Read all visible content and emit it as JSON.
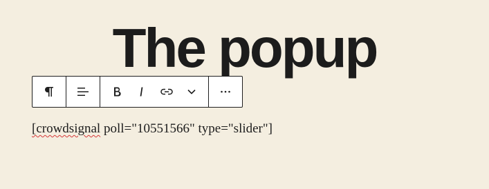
{
  "heading": {
    "text": "The popup"
  },
  "toolbar": {
    "paragraph_icon": "paragraph-icon",
    "align_icon": "align-left-icon",
    "bold_icon": "bold-icon",
    "italic_icon": "italic-icon",
    "link_icon": "link-icon",
    "more_rich_text_icon": "chevron-down-icon",
    "options_icon": "more-options-icon"
  },
  "content": {
    "misspelled_word": "[crowdsignal",
    "rest": " poll=\"10551566\" type=\"slider\"]"
  },
  "colors": {
    "background": "#f4eee0",
    "text": "#1c1c1c",
    "toolbar_border": "#1e1e1e",
    "spellcheck": "#d63638"
  }
}
